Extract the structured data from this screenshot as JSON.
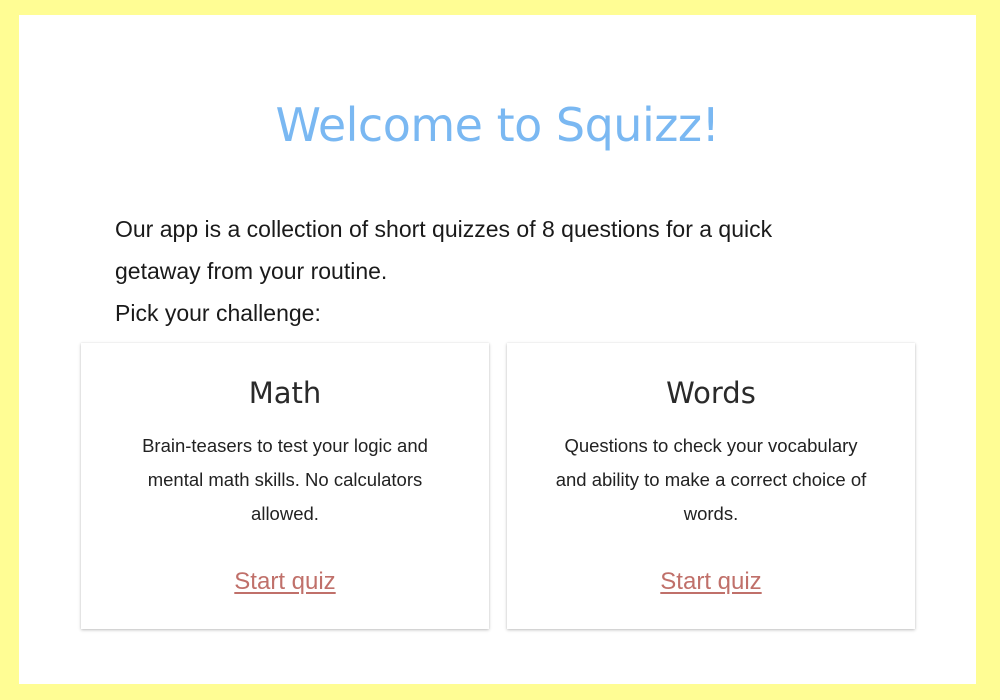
{
  "header": {
    "title": "Welcome to Squizz!"
  },
  "intro": {
    "line1": "Our app is a collection of short quizzes of 8 questions for a quick getaway from your routine.",
    "line2": "Pick your challenge:"
  },
  "cards": [
    {
      "title": "Math",
      "description": "Brain-teasers to test your logic and mental math skills. No calculators allowed.",
      "link_label": "Start quiz"
    },
    {
      "title": "Words",
      "description": "Questions to check your vocabulary and ability to make a correct choice of words.",
      "link_label": "Start quiz"
    }
  ],
  "colors": {
    "background": "#fffd94",
    "title": "#7ab8f2",
    "link": "#c0706a"
  }
}
